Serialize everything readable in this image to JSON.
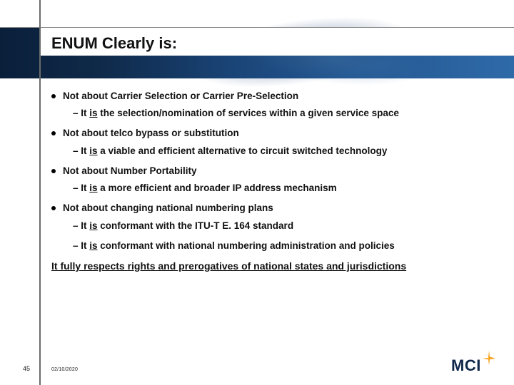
{
  "title": "ENUM Clearly is:",
  "bullets": [
    {
      "text": "Not about Carrier Selection or Carrier Pre-Selection",
      "subs": [
        {
          "prefix": "– It ",
          "is": "is",
          "rest": " the selection/nomination of services within a given service space"
        }
      ]
    },
    {
      "text": "Not about telco bypass or substitution",
      "subs": [
        {
          "prefix": "– It ",
          "is": "is",
          "rest": " a viable and efficient alternative to circuit switched technology"
        }
      ]
    },
    {
      "text": "Not about Number Portability",
      "subs": [
        {
          "prefix": "– It ",
          "is": "is",
          "rest": " a more efficient and broader IP address mechanism"
        }
      ]
    },
    {
      "text": "Not about changing national numbering plans",
      "subs": [
        {
          "prefix": "– It ",
          "is": "is",
          "rest": " conformant with the ITU-T E. 164 standard"
        },
        {
          "prefix": "– It ",
          "is": "is",
          "rest": " conformant with national numbering administration and policies"
        }
      ]
    }
  ],
  "summary": "It fully respects rights and prerogatives of national states and jurisdictions",
  "footer": {
    "page": "45",
    "date": "02/10/2020"
  },
  "logo": {
    "text": "MCI"
  },
  "colors": {
    "bannerDark": "#10284a",
    "accent": "#f5a623"
  }
}
